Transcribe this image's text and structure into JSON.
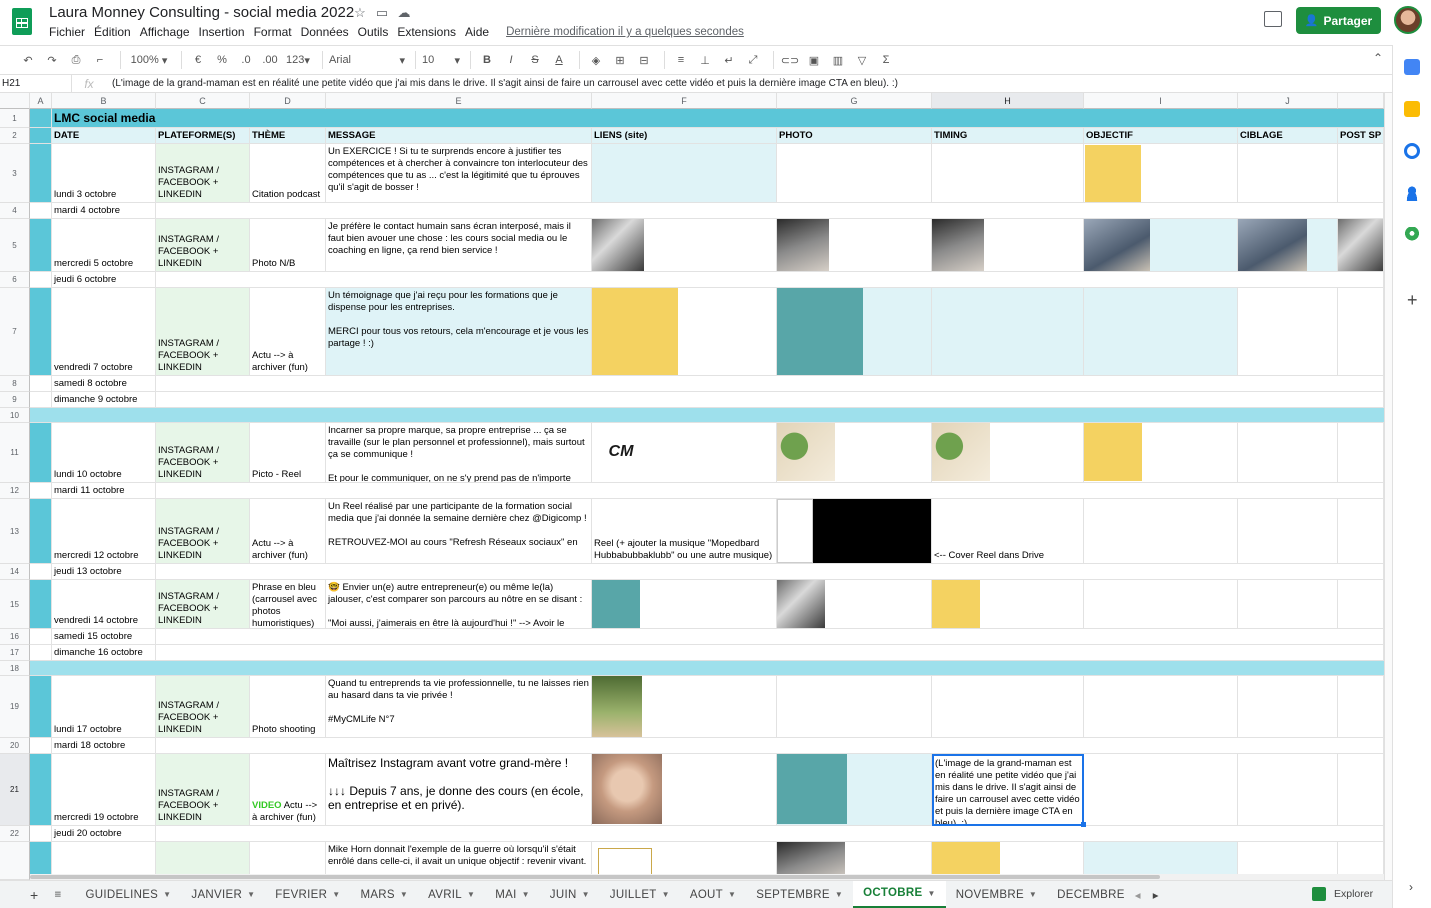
{
  "app": {
    "title": "Laura Monney Consulting - social media 2022",
    "menu": [
      "Fichier",
      "Édition",
      "Affichage",
      "Insertion",
      "Format",
      "Données",
      "Outils",
      "Extensions",
      "Aide"
    ],
    "last_modified": "Dernière modification il y a quelques secondes",
    "share_label": "Partager"
  },
  "toolbar": {
    "zoom": "100%",
    "currency": "€",
    "percent": "%",
    "decimals_less": ".0",
    "decimals_more": ".00",
    "number_format": "123",
    "font": "Arial",
    "font_size": "10",
    "bold": "B",
    "italic": "I",
    "strike": "S",
    "text_color": "A"
  },
  "formula_bar": {
    "cell_ref": "H21",
    "fx": "fx",
    "content": "(L'image de la grand-maman est en réalité une petite vidéo que j'ai mis dans le drive. Il s'agit ainsi de faire un carrousel avec cette vidéo et puis la dernière image CTA en bleu). :)"
  },
  "grid": {
    "columns": [
      "A",
      "B",
      "C",
      "D",
      "E",
      "F",
      "G",
      "H",
      "I",
      "J"
    ],
    "rows": [
      "1",
      "2",
      "3",
      "4",
      "5",
      "6",
      "7",
      "8",
      "9",
      "10",
      "11",
      "12",
      "13",
      "14",
      "15",
      "16",
      "17",
      "18",
      "19",
      "20",
      "21",
      "22"
    ],
    "title": "LMC social media",
    "headers": [
      "DATE",
      "PLATEFORME(S)",
      "THÈME",
      "MESSAGE",
      "LIENS (site)",
      "PHOTO",
      "TIMING",
      "OBJECTIF",
      "CIBLAGE",
      "POST SP"
    ],
    "platform": "INSTAGRAM / FACEBOOK + LINKEDIN",
    "r3": {
      "date": "lundi 3 octobre",
      "theme": "Citation podcast",
      "message": "Un EXERCICE ! Si tu te surprends encore à justifier tes compétences et à chercher à convaincre ton interlocuteur des compétences que tu as ... c'est la légitimité que tu éprouves qu'il s'agit de bosser !"
    },
    "r4": {
      "date": "mardi 4 octobre"
    },
    "r5": {
      "date": "mercredi 5 octobre",
      "theme": "Photo N/B",
      "message": "Je préfère le contact humain sans écran interposé, mais il faut bien avouer une chose : les cours social media ou le coaching en ligne, ça rend bien service !"
    },
    "r6": {
      "date": "jeudi 6 octobre"
    },
    "r7": {
      "date": "vendredi 7 octobre",
      "theme": "Actu --> à archiver (fun)",
      "message": "Un témoignage que j'ai reçu pour les formations que je dispense pour les entreprises.",
      "message2": "MERCI pour tous vos retours, cela m'encourage et je vous les partage ! :)"
    },
    "r8": {
      "date": "samedi 8 octobre"
    },
    "r9": {
      "date": "dimanche 9 octobre"
    },
    "r11": {
      "date": "lundi 10 octobre",
      "theme": "Picto - Reel",
      "message": "Incarner sa propre marque, sa propre entreprise ... ça se travaille (sur le plan personnel et professionnel), mais surtout ça se communique !",
      "message2": "Et pour le communiquer, on ne s'y prend pas de n'importe"
    },
    "r12": {
      "date": "mardi 11 octobre"
    },
    "r13": {
      "date": "mercredi 12 octobre",
      "theme": "Actu --> à archiver (fun)",
      "message": "Un Reel réalisé par une participante de la formation social media que j'ai donnée la semaine dernière chez @Digicomp !",
      "message2": "RETROUVEZ-MOI au cours \"Refresh Réseaux sociaux\" en",
      "link": "Reel (+ ajouter la musique \"Mopedbard Hubbabubbaklubb\" ou une autre musique)",
      "timing": "<-- Cover Reel dans Drive"
    },
    "r14": {
      "date": "jeudi 13 octobre"
    },
    "r15": {
      "date": "vendredi 14 octobre",
      "theme": "Phrase en bleu (carrousel avec photos humoristiques)",
      "message": "🤓 Envier un(e) autre entrepreneur(e) ou même le(la) jalouser, c'est comparer son parcours au nôtre en se disant :",
      "message2": "\"Moi aussi, j'aimerais en être là aujourd'hui !\" --> Avoir le"
    },
    "r16": {
      "date": "samedi 15 octobre"
    },
    "r17": {
      "date": "dimanche 16 octobre"
    },
    "r19": {
      "date": "lundi 17 octobre",
      "theme": "Photo shooting",
      "message": "Quand tu entreprends ta vie professionnelle, tu ne laisses rien au hasard dans ta vie privée !",
      "message2": "#MyCMLife N°7"
    },
    "r20": {
      "date": "mardi 18 octobre"
    },
    "r21": {
      "date": "mercredi 19 octobre",
      "theme_video": "VIDEO",
      "theme": "Actu --> à archiver (fun)",
      "message": "Maîtrisez Instagram avant votre grand-mère !",
      "message2": "↓↓↓ Depuis 7 ans, je donne des cours (en école, en entreprise et en privé).",
      "timing": "(L'image de la grand-maman est en réalité une petite vidéo que j'ai mis dans le drive. Il s'agit ainsi de faire un carrousel avec cette vidéo et puis la dernière image CTA en bleu). :)"
    },
    "r22": {
      "date": "jeudi 20 octobre"
    },
    "r23": {
      "message": "Mike Horn donnait l'exemple de la guerre où lorsqu'il s'était enrôlé dans celle-ci, il avait un unique objectif : revenir vivant."
    }
  },
  "sheets": {
    "tabs": [
      "GUIDELINES",
      "JANVIER",
      "FEVRIER",
      "MARS",
      "AVRIL",
      "MAI",
      "JUIN",
      "JUILLET",
      "AOUT",
      "SEPTEMBRE",
      "OCTOBRE",
      "NOVEMBRE",
      "DECEMBRE"
    ],
    "active": "OCTOBRE",
    "explore_label": "Explorer"
  },
  "colors": {
    "teal": "#5bc6d8",
    "light_teal": "#dff3f7",
    "green_fill": "#e7f6e8",
    "accent": "#1e8e3e"
  }
}
